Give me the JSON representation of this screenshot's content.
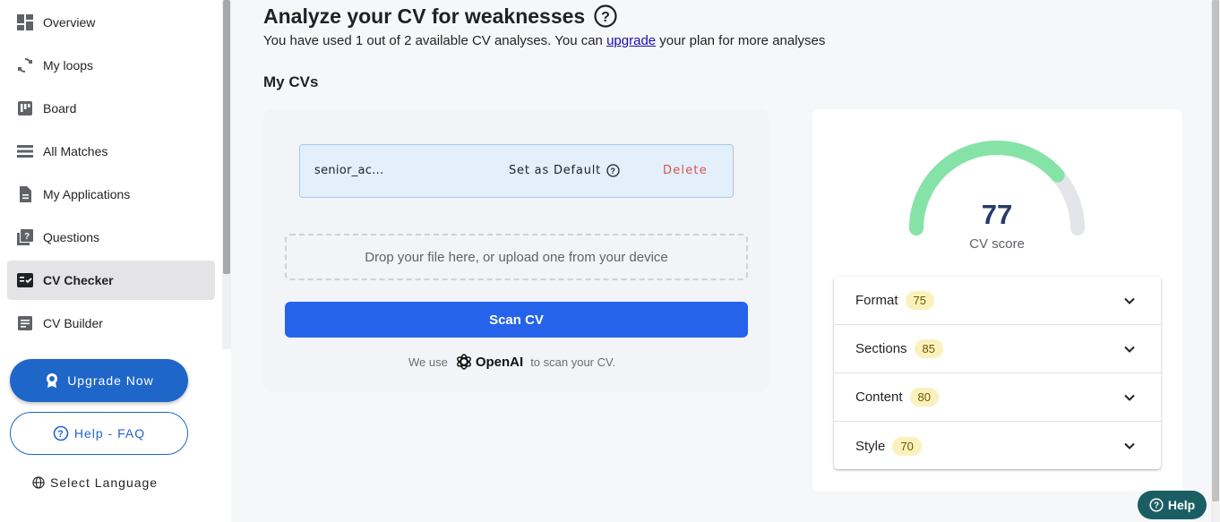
{
  "sidebar": {
    "items": [
      {
        "label": "Overview",
        "icon": "dashboard-icon"
      },
      {
        "label": "My loops",
        "icon": "loop-icon"
      },
      {
        "label": "Board",
        "icon": "board-icon"
      },
      {
        "label": "All Matches",
        "icon": "list-icon"
      },
      {
        "label": "My Applications",
        "icon": "document-icon"
      },
      {
        "label": "Questions",
        "icon": "question-icon"
      },
      {
        "label": "CV Checker",
        "icon": "checklist-icon",
        "active": true
      },
      {
        "label": "CV Builder",
        "icon": "form-icon"
      }
    ],
    "upgrade_label": "Upgrade Now",
    "help_faq_label": "Help - FAQ",
    "language_label": "Select Language"
  },
  "main": {
    "title": "Analyze your CV for weaknesses",
    "subtitle_prefix": "You have used 1 out of 2 available CV analyses. You can ",
    "subtitle_link": "upgrade",
    "subtitle_suffix": " your plan for more analyses",
    "section_title": "My CVs"
  },
  "cv": {
    "name": "senior_ac...",
    "set_default_label": "Set as Default",
    "delete_label": "Delete",
    "dropzone_text": "Drop your file here, or upload one from your device",
    "scan_label": "Scan CV",
    "note_prefix": "We use",
    "note_brand": "OpenAI",
    "note_suffix": "to scan your CV."
  },
  "score": {
    "value": "77",
    "fraction": 0.77,
    "label": "CV score",
    "breakdown": [
      {
        "label": "Format",
        "score": "75"
      },
      {
        "label": "Sections",
        "score": "85"
      },
      {
        "label": "Content",
        "score": "80"
      },
      {
        "label": "Style",
        "score": "70"
      }
    ]
  },
  "help_button": "Help",
  "colors": {
    "accent": "#1f66c9",
    "scan": "#2563eb",
    "gauge_fill": "#86e3a7",
    "gauge_track": "#e4e5e8",
    "delete": "#d9534f"
  }
}
